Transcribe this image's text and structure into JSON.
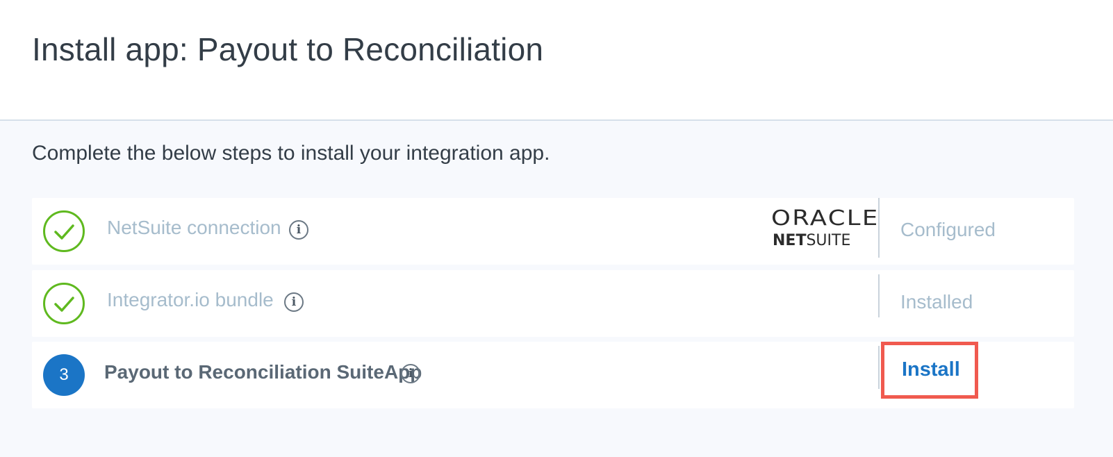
{
  "page": {
    "title": "Install app: Payout to Reconciliation",
    "instructions": "Complete the below steps to install your integration app."
  },
  "steps": [
    {
      "label": "NetSuite connection",
      "state": "complete",
      "status": "Configured",
      "logo": {
        "line1": "ORACLE",
        "line2_bold": "NET",
        "line2_regular": "SUITE"
      }
    },
    {
      "label": "Integrator.io bundle",
      "state": "complete",
      "status": "Installed"
    },
    {
      "number": "3",
      "label": "Payout to Reconciliation SuiteApp",
      "state": "current",
      "action": "Install"
    }
  ],
  "icons": {
    "info": "info-icon",
    "complete": "check-circle-icon"
  },
  "colors": {
    "complete_green": "#5fb91f",
    "accent_blue": "#1b75c6",
    "highlight_red": "#f05a4f",
    "muted_text": "#a6bccc"
  }
}
